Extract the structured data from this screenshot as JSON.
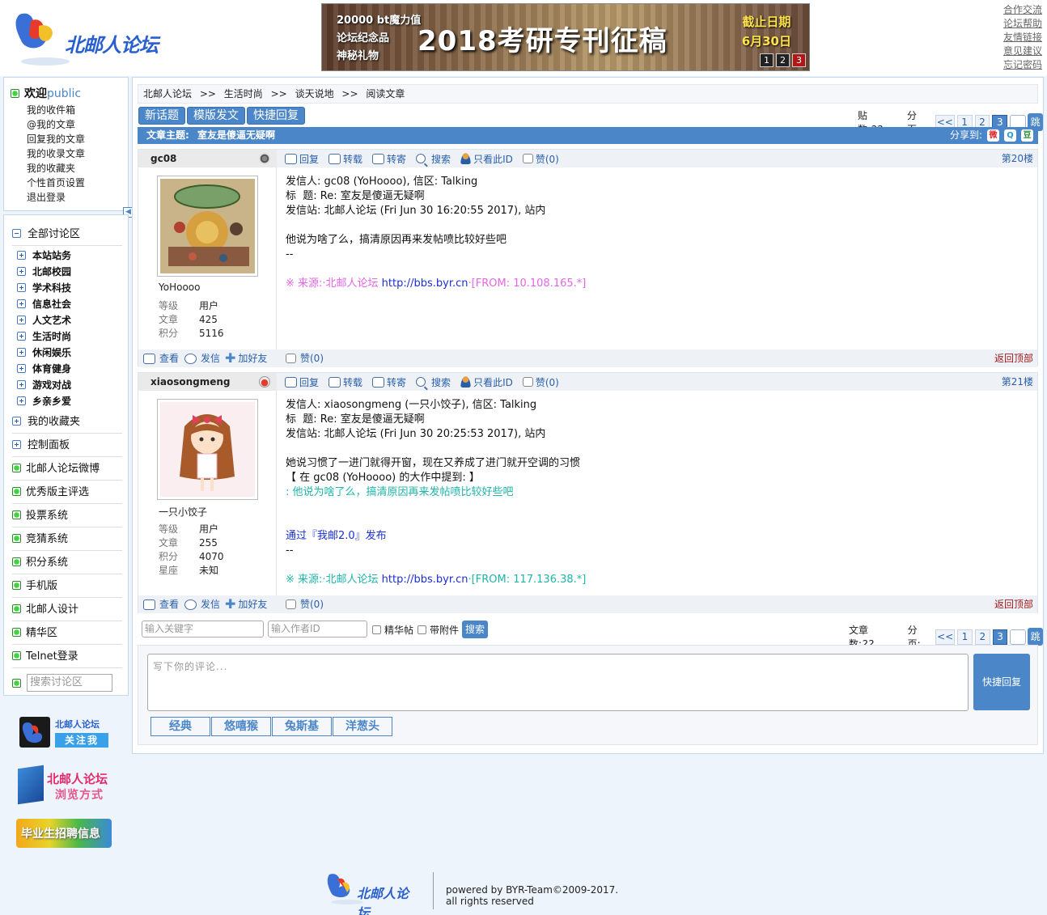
{
  "header": {
    "logo_text": "北邮人论坛",
    "banner": {
      "left_lines": [
        "20000 bt魔力值",
        "论坛纪念品",
        "神秘礼物"
      ],
      "main": "2018考研专刊征稿",
      "right_lines": [
        "截止日期",
        "6月30日"
      ],
      "dots": [
        "1",
        "2",
        "3"
      ]
    },
    "links": [
      "合作交流",
      "论坛帮助",
      "友情链接",
      "意见建议",
      "忘记密码"
    ]
  },
  "user_panel": {
    "welcome": "欢迎",
    "username": "public",
    "items": [
      "我的收件箱",
      "@我的文章",
      "回复我的文章",
      "我的收录文章",
      "我的收藏夹",
      "个性首页设置",
      "退出登录"
    ]
  },
  "nav": {
    "all_label": "全部讨论区",
    "sections": [
      "本站站务",
      "北邮校园",
      "学术科技",
      "信息社会",
      "人文艺术",
      "生活时尚",
      "休闲娱乐",
      "体育健身",
      "游戏对战",
      "乡亲乡爱"
    ],
    "favorites": "我的收藏夹",
    "control": "控制面板",
    "links": [
      "北邮人论坛微博",
      "优秀版主评选",
      "投票系统",
      "竞猜系统",
      "积分系统",
      "手机版",
      "北邮人设计",
      "精华区",
      "Telnet登录"
    ],
    "search_placeholder": "搜索讨论区"
  },
  "side_ads": {
    "weibo_title": "北邮人论坛",
    "weibo_follow": "关注我",
    "browse_title": "北邮人论坛",
    "browse_sub": "浏览方式",
    "jobs": "毕业生招聘信息"
  },
  "breadcrumb": [
    "北邮人论坛",
    "生活时尚",
    "谈天说地",
    "阅读文章"
  ],
  "breadcrumb_sep": ">>",
  "toolbar": {
    "new_topic": "新话题",
    "template_post": "模版发文",
    "quick_reply": "快捷回复"
  },
  "pager_top": {
    "count_label": "贴数:",
    "count": "22",
    "page_label": "分页:",
    "prev": "<<",
    "pages": [
      "1",
      "2",
      "3"
    ],
    "current": "3",
    "go": "跳"
  },
  "subject": {
    "label": "文章主题:",
    "title": "室友是傻逼无疑啊",
    "share_label": "分享到:"
  },
  "post_actions": [
    "回复",
    "转载",
    "转寄",
    "搜索",
    "只看此ID",
    "赞(0)"
  ],
  "user_actions": [
    "查看",
    "发信",
    "加好友"
  ],
  "back_top": "返回顶部",
  "posts": [
    {
      "user": "gc08",
      "nick": "YoHoooo",
      "floor": "第20楼",
      "stats": [
        [
          "等级",
          "用户"
        ],
        [
          "文章",
          "425"
        ],
        [
          "积分",
          "5116"
        ]
      ],
      "lines": [
        "发信人: gc08 (YoHoooo), 信区: Talking",
        "标  题: Re: 室友是傻逼无疑啊",
        "发信站: 北邮人论坛 (Fri Jun 30 16:20:55 2017), 站内",
        "",
        "他说为啥了么，搞清原因再来发帖喷比较好些吧",
        "--",
        ""
      ],
      "source_prefix": "※ 来源:·北邮人论坛 ",
      "source_url": "http://bbs.byr.cn",
      "source_suffix": "·[FROM: 10.108.165.*]",
      "like": "赞(0)"
    },
    {
      "user": "xiaosongmeng",
      "nick": "一只小饺子",
      "floor": "第21楼",
      "stats": [
        [
          "等级",
          "用户"
        ],
        [
          "文章",
          "255"
        ],
        [
          "积分",
          "4070"
        ],
        [
          "星座",
          "未知"
        ]
      ],
      "lines": [
        "发信人: xiaosongmeng (一只小饺子), 信区: Talking",
        "标  题: Re: 室友是傻逼无疑啊",
        "发信站: 北邮人论坛 (Fri Jun 30 20:25:53 2017), 站内",
        "",
        "她说习惯了一进门就得开窗，现在又养成了进门就开空调的习惯",
        "【 在 gc08 (YoHoooo) 的大作中提到: 】"
      ],
      "quote": ": 他说为啥了么，搞清原因再来发帖喷比较好些吧",
      "via": "通过『我邮2.0』发布",
      "dash": "--",
      "source_prefix": "※ 来源:·北邮人论坛 ",
      "source_url": "http://bbs.byr.cn",
      "source_suffix": "·[FROM: 117.136.38.*]",
      "like": "赞(0)"
    }
  ],
  "search_row": {
    "keyword_placeholder": "输入关键字",
    "author_placeholder": "输入作者ID",
    "elite_label": "精华帖",
    "attach_label": "带附件",
    "search_btn": "搜索",
    "count_label": "文章数:",
    "count": "22"
  },
  "reply": {
    "placeholder": "写下你的评论...",
    "send": "快捷回复",
    "emoji_tabs": [
      "经典",
      "悠嘻猴",
      "兔斯基",
      "洋葱头"
    ]
  },
  "footer": {
    "powered": "powered by BYR-Team©2009-2017.",
    "rights": "all rights reserved"
  }
}
